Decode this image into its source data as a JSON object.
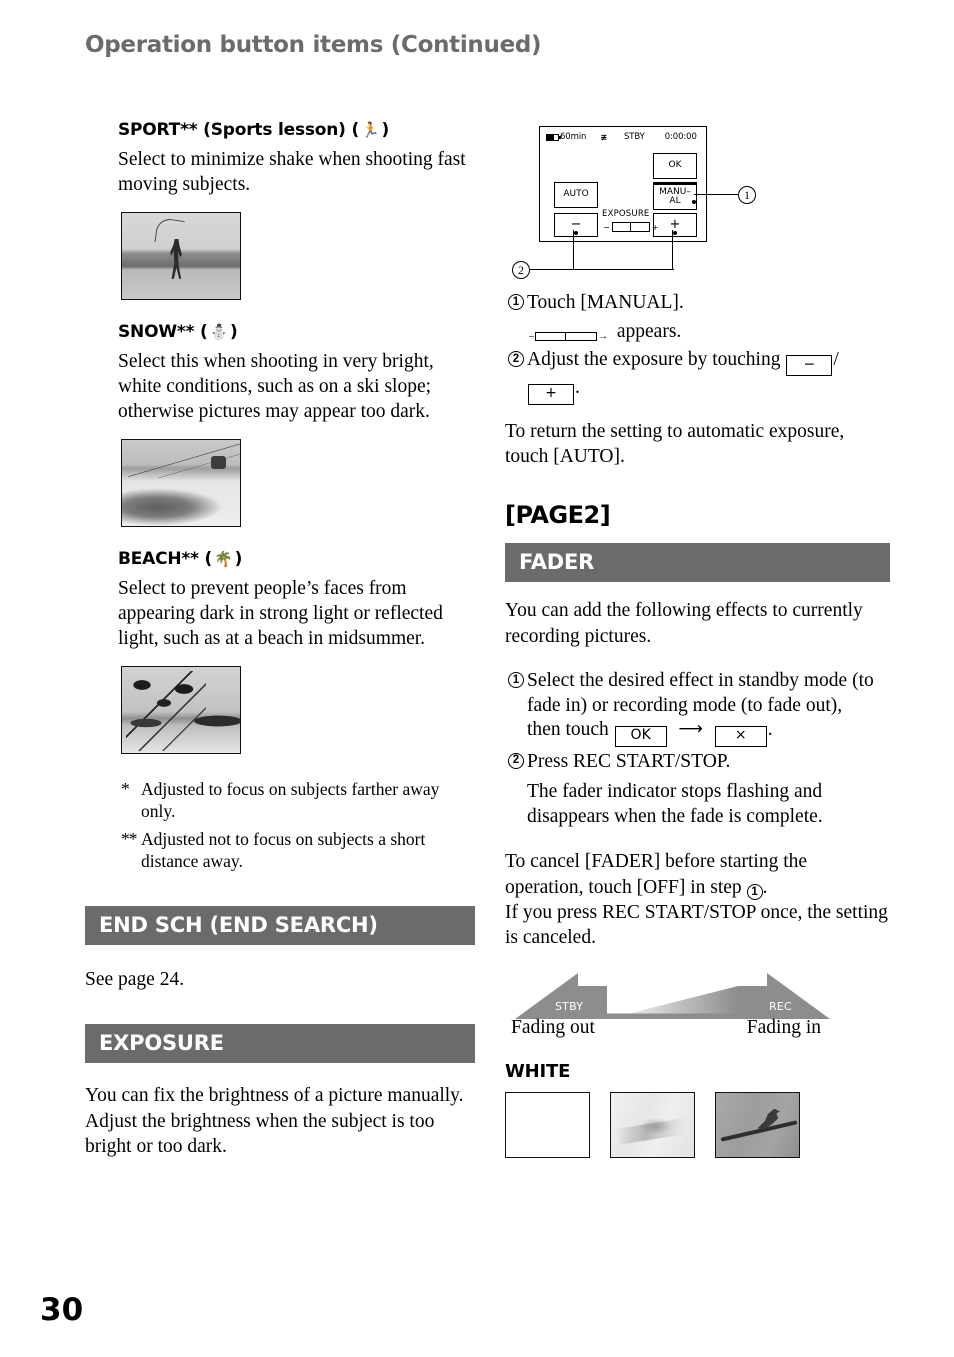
{
  "header": {
    "title": "Operation button items (Continued)"
  },
  "folio": {
    "page_number": "30"
  },
  "left_column": {
    "sport": {
      "heading": "SPORT** (Sports lesson) (",
      "heading_close": ")",
      "icon": "running-person-icon",
      "body": "Select to minimize shake when shooting fast moving subjects.",
      "photo_caption": "golfer-swing-photo"
    },
    "snow": {
      "heading": "SNOW** (",
      "heading_close": ")",
      "icon": "snowman-icon",
      "body": "Select this when shooting in very bright, white conditions, such as on a ski slope; otherwise pictures may appear too dark.",
      "photo_caption": "ski-slope-gondola-photo"
    },
    "beach": {
      "heading": "BEACH** (",
      "heading_close": ")",
      "icon": "palm-tree-icon",
      "body": "Select to prevent people’s faces from appearing dark in strong light or reflected light, such as at a beach in midsummer.",
      "photo_caption": "tropical-beach-palms-photo"
    },
    "footnotes": [
      {
        "mark": "*",
        "text": "Adjusted to focus on subjects farther away only."
      },
      {
        "mark": "**",
        "text": "Adjusted not to focus on subjects a short distance away."
      }
    ],
    "end_search": {
      "bar_title": "END SCH (END SEARCH)",
      "body": "See page 24."
    },
    "exposure": {
      "bar_title": "EXPOSURE",
      "body": "You can fix the brightness of a picture manually. Adjust the brightness when the subject is too bright or too dark."
    }
  },
  "right_column": {
    "lcd_diagram": {
      "status_battery": "60min",
      "status_mode_icon": "sp-mode-icon",
      "status_recording": "STBY",
      "status_timecode": "0:00:00",
      "button_ok": "OK",
      "button_manual_line1": "MANU–",
      "button_manual_line2": "AL",
      "button_auto": "AUTO",
      "button_minus": "−",
      "button_plus": "+",
      "exposure_label": "EXPOSURE",
      "scale_minus": "−",
      "scale_plus": "+",
      "callout_1": "1",
      "callout_2": "2"
    },
    "exposure_steps": [
      {
        "num": "1",
        "text": "Touch [MANUAL]."
      },
      {
        "num": "2",
        "text": "Adjust the exposure by touching"
      }
    ],
    "step1_sub": "appears.",
    "step2_key_minus": "─",
    "step2_separator": "/",
    "step2_key_plus": "+",
    "step2_period": ".",
    "exposure_return": "To return the setting to automatic exposure, touch [AUTO].",
    "page2_title": "[PAGE2]",
    "fader": {
      "bar_title": "FADER",
      "intro": "You can add the following effects to currently recording pictures.",
      "step1_a": "Select the desired effect in standby mode (to fade in) or recording mode (to fade out),",
      "step1_b": "then touch",
      "step1_key_ok": "OK",
      "step1_key_x": "×",
      "step1_period": ".",
      "step2": "Press REC START/STOP.",
      "step2_sub": "The fader indicator stops flashing and disappears when the fade is complete.",
      "cancel_text": "To cancel [FADER] before starting the operation, touch [OFF] in step",
      "cancel_step_num": "1",
      "cancel_period": ".",
      "cancel_text2": "If you press REC START/STOP once, the setting is canceled.",
      "diagram": {
        "label_stby": "STBY",
        "label_rec": "REC",
        "caption_left": "Fading out",
        "caption_right": "Fading in"
      },
      "white": {
        "heading": "WHITE",
        "frames": [
          "white-blank-frame",
          "white-faded-bird-frame",
          "bird-on-branch-frame"
        ]
      }
    }
  },
  "colors": {
    "bar_gray": "#6b6b6b",
    "header_gray": "#6b6b6b",
    "text_black": "#000000",
    "page_white": "#ffffff"
  }
}
